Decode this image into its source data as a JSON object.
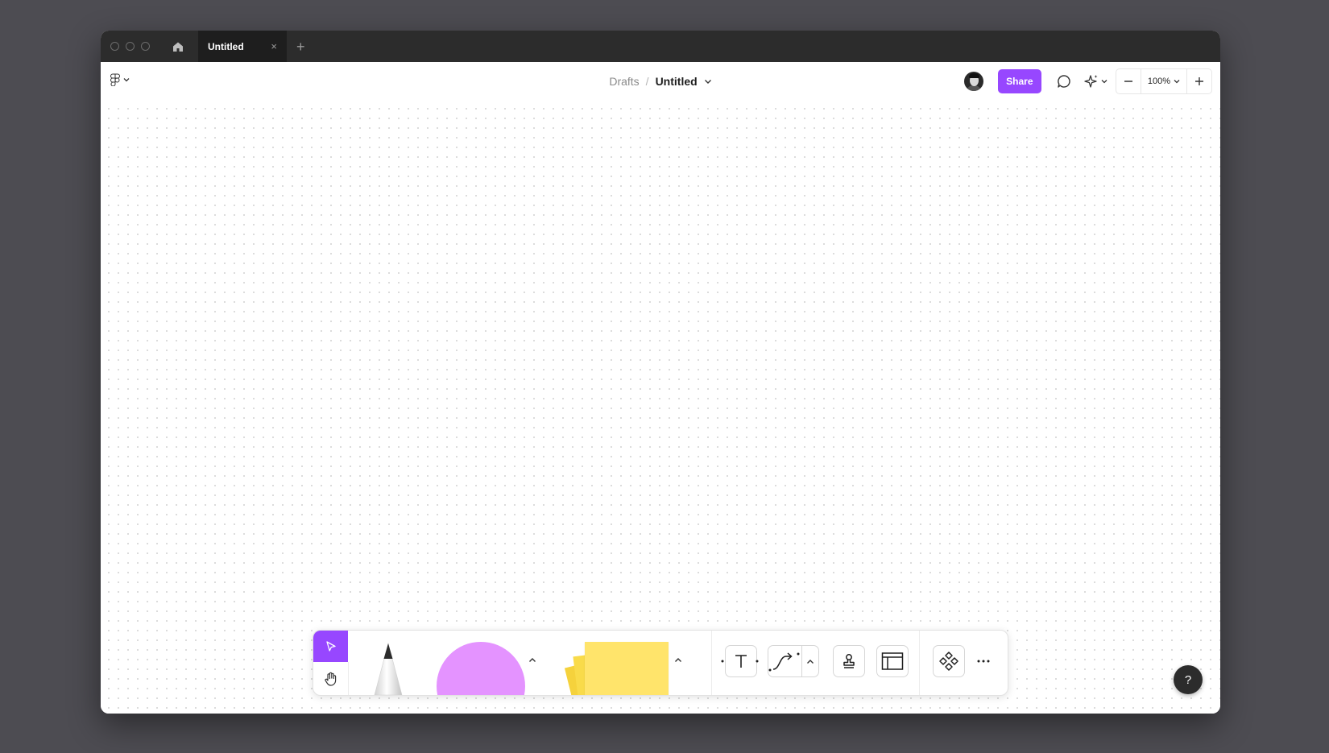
{
  "window": {
    "tab_title": "Untitled",
    "tab_close": "×",
    "new_tab": "+"
  },
  "topbar": {
    "menu_icon": "figma-logo-icon",
    "breadcrumb": {
      "parent": "Drafts",
      "separator": "/",
      "title": "Untitled"
    },
    "share_label": "Share",
    "zoom_level": "100%",
    "zoom_out": "−",
    "zoom_in": "+"
  },
  "toolbar": {
    "tools": [
      {
        "name": "select",
        "icon": "cursor-icon",
        "active": true
      },
      {
        "name": "hand",
        "icon": "hand-icon"
      },
      {
        "name": "pencil",
        "icon": "marker-icon"
      },
      {
        "name": "shape",
        "icon": "circle-shape-icon"
      },
      {
        "name": "sticky",
        "icon": "sticky-note-icon"
      },
      {
        "name": "text",
        "icon": "text-icon"
      },
      {
        "name": "connector",
        "icon": "connector-icon"
      },
      {
        "name": "stamp",
        "icon": "stamp-icon"
      },
      {
        "name": "section",
        "icon": "section-icon"
      },
      {
        "name": "components",
        "icon": "components-icon"
      }
    ],
    "more_label": "···"
  },
  "help": {
    "label": "?"
  },
  "colors": {
    "accent": "#9747ff",
    "shape": "#e493ff",
    "sticky": "#ffe46b",
    "titlebar": "#2c2c2c",
    "backdrop": "#4d4c52"
  }
}
